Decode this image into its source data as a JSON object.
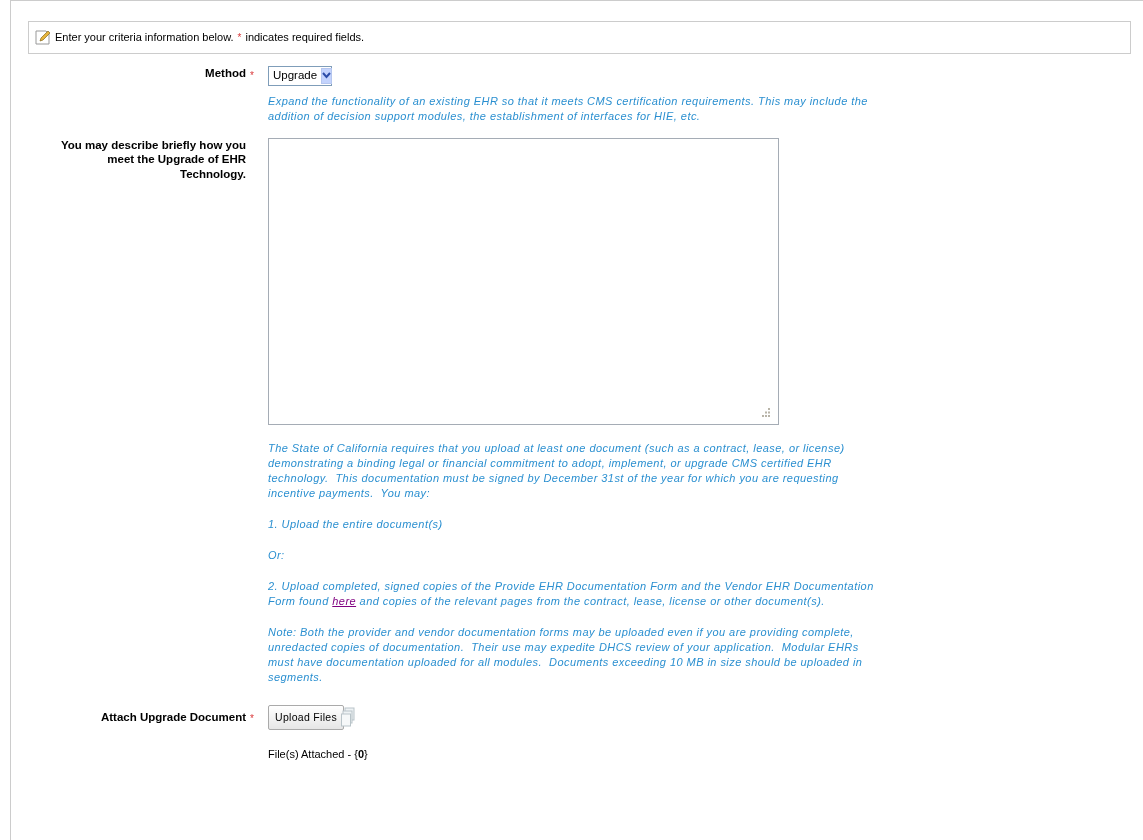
{
  "intro": {
    "before": "Enter your criteria information below.",
    "mark": "*",
    "after": "indicates required fields."
  },
  "method": {
    "label": "Method",
    "required": true,
    "value": "Upgrade",
    "help": "Expand the functionality of an existing EHR so that it meets CMS certification requirements. This may include the addition of decision support modules, the establishment of interfaces for HIE, etc."
  },
  "description": {
    "label": "You may describe briefly how you meet the Upgrade of EHR Technology.",
    "required": false
  },
  "instructions": [
    {
      "kind": "text",
      "text": "The State of California requires that you upload at least one document (such as a contract, lease, or license) demonstrating a binding legal or financial commitment to adopt, implement, or upgrade CMS certified EHR technology.  This documentation must be signed by December 31st of the year for which you are requesting incentive payments.  You may:"
    },
    {
      "kind": "text",
      "text": "1. Upload the entire document(s)"
    },
    {
      "kind": "text",
      "text": "Or:"
    },
    {
      "kind": "link",
      "before": "2. Upload completed, signed copies of the Provide EHR Documentation Form and the Vendor EHR Documentation Form found",
      "link": "here",
      "after": "and copies of the relevant pages from the contract, lease, license or other document(s)."
    },
    {
      "kind": "text",
      "text": "Note: Both the provider and vendor documentation forms may be uploaded even if you are providing complete, unredacted copies of documentation.  Their use may expedite DHCS review of your application.  Modular EHRs must have documentation uploaded for all modules.  Documents exceeding 10 MB in size should be uploaded in segments."
    }
  ],
  "attach": {
    "label": "Attach Upgrade Document",
    "required": true,
    "button": "Upload Files",
    "status": "File(s) Attached - {**0**}"
  }
}
